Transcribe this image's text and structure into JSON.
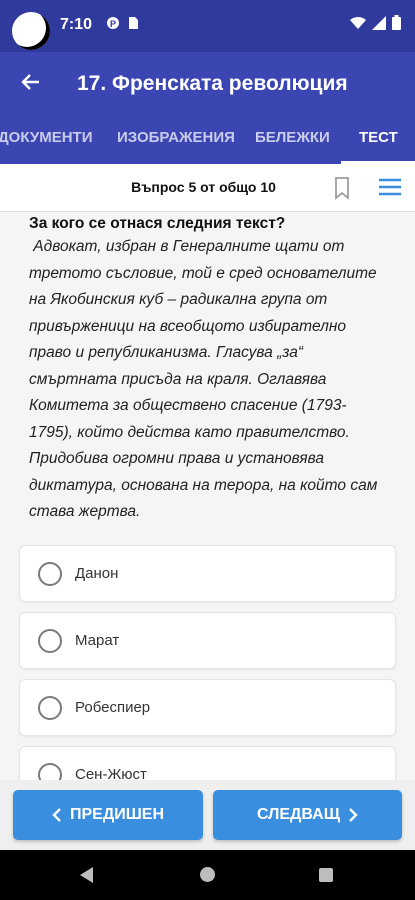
{
  "status_bar": {
    "time": "7:10",
    "icons": [
      "notification-icon",
      "sd-card-icon",
      "wifi-icon",
      "signal-icon",
      "battery-icon"
    ]
  },
  "app_bar": {
    "title": "17. Френската революция",
    "back_icon": "arrow-left-icon"
  },
  "tabs": [
    {
      "label": "ДОКУМЕНТИ",
      "active": false
    },
    {
      "label": "ИЗОБРАЖЕНИЯ",
      "active": false
    },
    {
      "label": "БЕЛЕЖКИ",
      "active": false
    },
    {
      "label": "ТЕСТ",
      "active": true
    }
  ],
  "question_header": {
    "counter": "Въпрос 5 от общо 10",
    "bookmark_icon": "bookmark-icon",
    "menu_icon": "menu-icon"
  },
  "question": {
    "title": "За кого се отнася следния текст?",
    "text_lines": [
      " Адвокат, избран в Генералните щати от",
      "третото съсловие, той е сред основателите",
      "на Якобинския куб – радикална група от",
      "привърженици на всеобщото избирателно",
      "право и републиканизма. Гласува „за“",
      "смъртната присъда на краля. Оглавява",
      "Комитета за обществено спасение (1793-",
      "1795), който действа като правителство.",
      "Придобива огромни права и установява",
      "диктатура, основана на терора, на който сам",
      "става жертва."
    ]
  },
  "answers": [
    {
      "label": "Данон"
    },
    {
      "label": "Марат"
    },
    {
      "label": "Робеспиер"
    },
    {
      "label": "Сен-Жюст"
    }
  ],
  "navigation": {
    "prev_label": "ПРЕДИШЕН",
    "next_label": "СЛЕДВАЩ"
  },
  "colors": {
    "status_bar": "#2f3a9c",
    "app_bar": "#3b46b3",
    "button": "#3a8ee0"
  }
}
